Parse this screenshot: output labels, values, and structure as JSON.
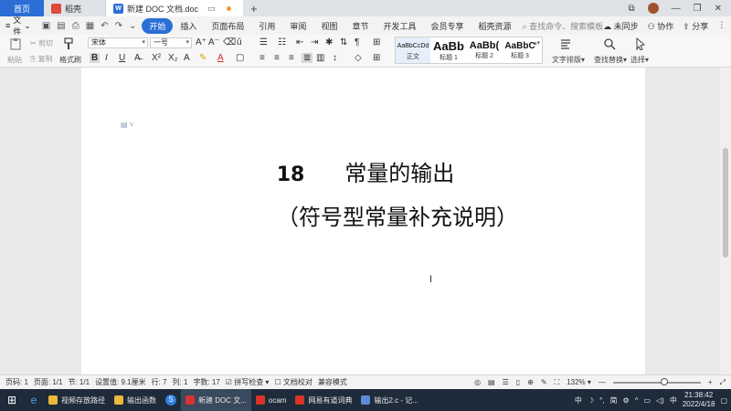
{
  "titlebar": {
    "tabs": [
      {
        "label": "首页"
      },
      {
        "label": "稻壳"
      },
      {
        "label": "新建 DOC 文档.doc"
      }
    ],
    "new_tab": "+",
    "minimize": "—",
    "maximize": "❐",
    "close": "✕",
    "restore": "⧉"
  },
  "menubar": {
    "file": "文件",
    "items": [
      "开始",
      "插入",
      "页面布局",
      "引用",
      "审阅",
      "视图",
      "章节",
      "开发工具",
      "会员专享",
      "稻壳资源"
    ],
    "search_placeholder": "查找命令、搜索模板",
    "sync": "未同步",
    "collab": "协作",
    "share": "分享"
  },
  "ribbon": {
    "paste": "粘贴",
    "cut": "剪切",
    "copy": "复制",
    "format_painter": "格式刷",
    "font_name": "宋体",
    "font_size": "一号",
    "styles": [
      {
        "sample": "AaBbCcDd",
        "name": "正文"
      },
      {
        "sample": "AaBb",
        "name": "标题 1"
      },
      {
        "sample": "AaBb(",
        "name": "标题 2"
      },
      {
        "sample": "AaBbC",
        "name": "标题 3"
      }
    ],
    "text_layout": "文字排版",
    "find_replace": "查找替换",
    "select": "选择"
  },
  "document": {
    "heading_number": "18",
    "heading_text": "常量的输出",
    "subheading": "（符号型常量补充说明）"
  },
  "statusbar": {
    "page": "页码: 1",
    "pages": "页面: 1/1",
    "section": "节: 1/1",
    "setting": "设置值: 9.1厘米",
    "row": "行: 7",
    "col": "列: 1",
    "words": "字数: 17",
    "spellcheck": "拼写检查",
    "proofread": "文档校对",
    "compat": "兼容模式",
    "zoom": "132%",
    "zoom_minus": "—",
    "zoom_plus": "+"
  },
  "taskbar": {
    "apps": [
      {
        "label": "视频存放路径",
        "color": "#e8b93a"
      },
      {
        "label": "输出函数",
        "color": "#e8b93a"
      },
      {
        "label": "新建 DOC 文...",
        "color": "#d9342b"
      },
      {
        "label": "ocam",
        "color": "#d9342b"
      },
      {
        "label": "网易有道词典",
        "color": "#d9342b"
      },
      {
        "label": "输出2.c - 记...",
        "color": "#5b8bd6"
      }
    ],
    "ime": "中",
    "ime2": "简",
    "time": "21:38:42",
    "date": "2022/4/18"
  }
}
